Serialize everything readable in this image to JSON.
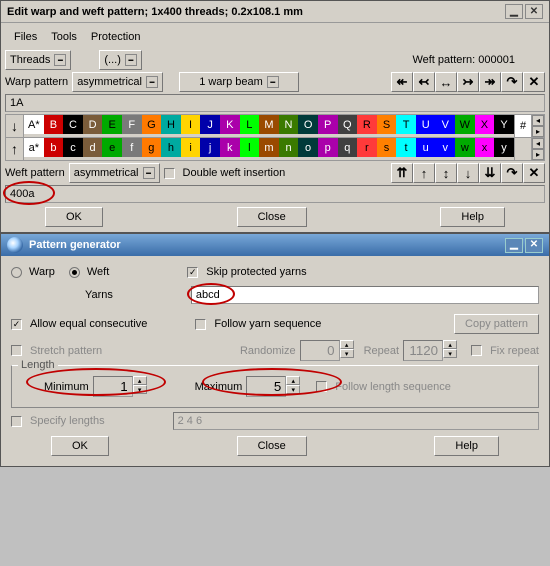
{
  "top_window": {
    "title": "Edit warp and weft pattern; 1x400 threads; 0.2x108.1 mm",
    "menu": {
      "files": "Files",
      "tools": "Tools",
      "protection": "Protection"
    },
    "threads_btn": "Threads",
    "paren_btn": "(...)",
    "weft_pattern_label": "Weft pattern: 000001",
    "warp_pattern_label": "Warp pattern",
    "warp_pattern_value": "asymmetrical",
    "warp_beam_value": "1 warp beam",
    "arrows1": [
      "↞",
      "↢",
      "↔",
      "↣",
      "↠",
      "↷",
      "✕"
    ],
    "warp_input": "1A",
    "down_arrow": "↓",
    "up_arrow": "↑",
    "upper_row": [
      {
        "l": "A*",
        "bg": "#ffffff",
        "fg": "#000"
      },
      {
        "l": "B",
        "bg": "#cc0000",
        "fg": "#fff"
      },
      {
        "l": "C",
        "bg": "#000000",
        "fg": "#fff"
      },
      {
        "l": "D",
        "bg": "#7a5c3a",
        "fg": "#fff"
      },
      {
        "l": "E",
        "bg": "#00aa00",
        "fg": "#000"
      },
      {
        "l": "F",
        "bg": "#7a7a7a",
        "fg": "#fff"
      },
      {
        "l": "G",
        "bg": "#ff7a00",
        "fg": "#000"
      },
      {
        "l": "H",
        "bg": "#00aaa0",
        "fg": "#000"
      },
      {
        "l": "I",
        "bg": "#ffd400",
        "fg": "#000"
      },
      {
        "l": "J",
        "bg": "#0000aa",
        "fg": "#fff"
      },
      {
        "l": "K",
        "bg": "#aa00aa",
        "fg": "#fff"
      },
      {
        "l": "L",
        "bg": "#00ff00",
        "fg": "#000"
      },
      {
        "l": "M",
        "bg": "#9a4a00",
        "fg": "#fff"
      },
      {
        "l": "N",
        "bg": "#3a7a00",
        "fg": "#fff"
      },
      {
        "l": "O",
        "bg": "#003a3a",
        "fg": "#fff"
      },
      {
        "l": "P",
        "bg": "#aa00aa",
        "fg": "#fff"
      },
      {
        "l": "Q",
        "bg": "#404040",
        "fg": "#fff"
      },
      {
        "l": "R",
        "bg": "#ff3a3a",
        "fg": "#000"
      },
      {
        "l": "S",
        "bg": "#ff8000",
        "fg": "#000"
      },
      {
        "l": "T",
        "bg": "#00ffff",
        "fg": "#000"
      },
      {
        "l": "U",
        "bg": "#0000ff",
        "fg": "#fff"
      },
      {
        "l": "V",
        "bg": "#0000ff",
        "fg": "#fff"
      },
      {
        "l": "W",
        "bg": "#00aa00",
        "fg": "#000"
      },
      {
        "l": "X",
        "bg": "#ff00ff",
        "fg": "#000"
      },
      {
        "l": "Y",
        "bg": "#000000",
        "fg": "#fff"
      }
    ],
    "lower_row": [
      {
        "l": "a*",
        "bg": "#ffffff",
        "fg": "#000"
      },
      {
        "l": "b",
        "bg": "#cc0000",
        "fg": "#fff"
      },
      {
        "l": "c",
        "bg": "#000000",
        "fg": "#fff"
      },
      {
        "l": "d",
        "bg": "#7a5c3a",
        "fg": "#fff"
      },
      {
        "l": "e",
        "bg": "#00aa00",
        "fg": "#000"
      },
      {
        "l": "f",
        "bg": "#7a7a7a",
        "fg": "#fff"
      },
      {
        "l": "g",
        "bg": "#ff7a00",
        "fg": "#000"
      },
      {
        "l": "h",
        "bg": "#00aaa0",
        "fg": "#000"
      },
      {
        "l": "i",
        "bg": "#ffd400",
        "fg": "#000"
      },
      {
        "l": "j",
        "bg": "#0000aa",
        "fg": "#fff"
      },
      {
        "l": "k",
        "bg": "#aa00aa",
        "fg": "#fff"
      },
      {
        "l": "l",
        "bg": "#00ff00",
        "fg": "#000"
      },
      {
        "l": "m",
        "bg": "#9a4a00",
        "fg": "#fff"
      },
      {
        "l": "n",
        "bg": "#3a7a00",
        "fg": "#fff"
      },
      {
        "l": "o",
        "bg": "#003a3a",
        "fg": "#fff"
      },
      {
        "l": "p",
        "bg": "#aa00aa",
        "fg": "#fff"
      },
      {
        "l": "q",
        "bg": "#404040",
        "fg": "#fff"
      },
      {
        "l": "r",
        "bg": "#ff3a3a",
        "fg": "#000"
      },
      {
        "l": "s",
        "bg": "#ff8000",
        "fg": "#000"
      },
      {
        "l": "t",
        "bg": "#00ffff",
        "fg": "#000"
      },
      {
        "l": "u",
        "bg": "#0000ff",
        "fg": "#fff"
      },
      {
        "l": "v",
        "bg": "#0000ff",
        "fg": "#fff"
      },
      {
        "l": "w",
        "bg": "#00aa00",
        "fg": "#000"
      },
      {
        "l": "x",
        "bg": "#ff00ff",
        "fg": "#000"
      },
      {
        "l": "y",
        "bg": "#000000",
        "fg": "#fff"
      }
    ],
    "hash": "#",
    "weft_pattern_label2": "Weft pattern",
    "weft_pattern_value": "asymmetrical",
    "double_weft": "Double weft insertion",
    "arrows2": [
      "⇈",
      "↑",
      "↕",
      "↓",
      "⇊",
      "↷",
      "✕"
    ],
    "weft_input": "400a",
    "ok": "OK",
    "close": "Close",
    "help": "Help"
  },
  "bottom_window": {
    "title": "Pattern generator",
    "warp": "Warp",
    "weft": "Weft",
    "skip": "Skip protected yarns",
    "yarns_label": "Yarns",
    "yarns_value": "abcd",
    "allow_equal": "Allow equal consecutive",
    "follow_yarn": "Follow yarn sequence",
    "copy_pattern": "Copy pattern",
    "stretch": "Stretch pattern",
    "randomize_label": "Randomize",
    "randomize_value": "0",
    "repeat_label": "Repeat",
    "repeat_value": "1120",
    "fix_repeat": "Fix repeat",
    "length_legend": "Length",
    "min_label": "Minimum",
    "min_value": "1",
    "max_label": "Maximum",
    "max_value": "5",
    "follow_length": "Follow length sequence",
    "specify": "Specify lengths",
    "specify_value": "2 4 6",
    "ok": "OK",
    "close": "Close",
    "help": "Help"
  }
}
